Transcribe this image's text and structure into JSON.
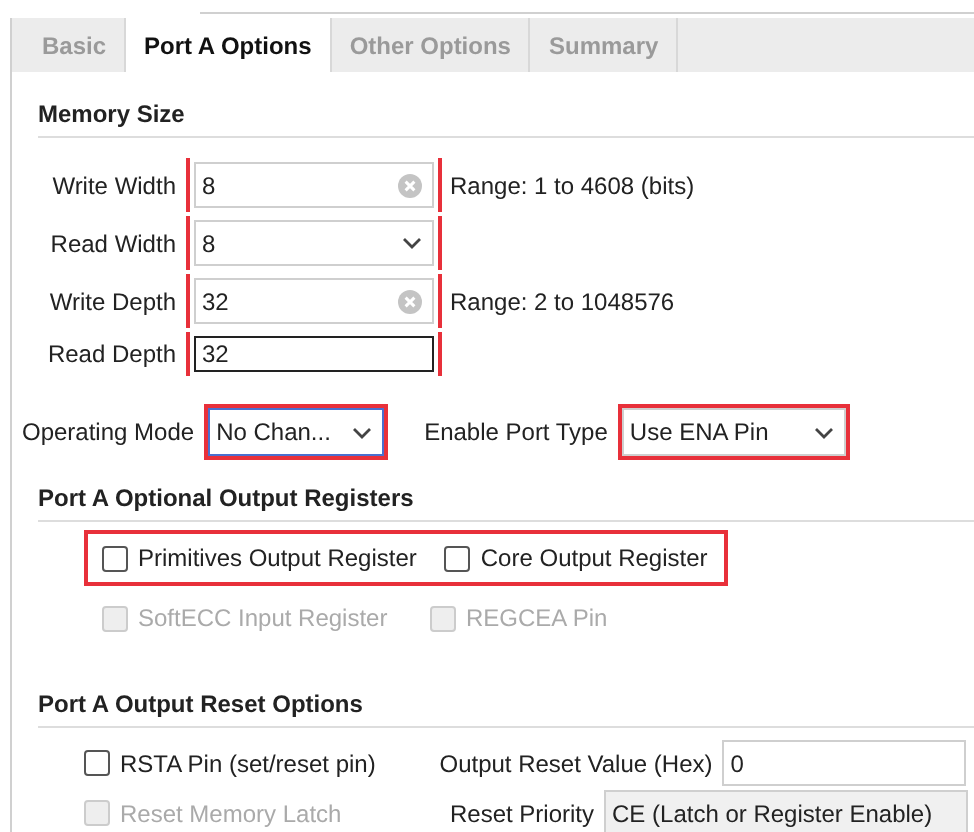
{
  "tabs": [
    {
      "label": "Basic",
      "selected": false
    },
    {
      "label": "Port A Options",
      "selected": true
    },
    {
      "label": "Other Options",
      "selected": false
    },
    {
      "label": "Summary",
      "selected": false
    }
  ],
  "memory_size": {
    "title": "Memory Size",
    "highlighted": true,
    "fields": [
      {
        "label": "Write Width",
        "value": "8",
        "kind": "clearable",
        "hint": "Range: 1 to 4608 (bits)"
      },
      {
        "label": "Read Width",
        "value": "8",
        "kind": "dropdown"
      },
      {
        "label": "Write Depth",
        "value": "32",
        "kind": "clearable",
        "hint": "Range: 2 to 1048576"
      },
      {
        "label": "Read Depth",
        "value": "32",
        "kind": "readonly"
      }
    ]
  },
  "modes": [
    {
      "label": "Operating Mode",
      "value": "No Chan...",
      "highlighted": true,
      "focused": true
    },
    {
      "label": "Enable Port Type",
      "value": "Use ENA Pin",
      "highlighted": true,
      "focused": false
    }
  ],
  "output_registers": {
    "title": "Port A Optional Output Registers",
    "rows": [
      {
        "highlighted": true,
        "items": [
          {
            "label": "Primitives Output Register",
            "checked": false,
            "disabled": false
          },
          {
            "label": "Core Output Register",
            "checked": false,
            "disabled": false
          }
        ]
      },
      {
        "highlighted": false,
        "items": [
          {
            "label": "SoftECC Input Register",
            "checked": false,
            "disabled": true
          },
          {
            "label": "REGCEA Pin",
            "checked": false,
            "disabled": true
          }
        ]
      }
    ]
  },
  "reset_options": {
    "title": "Port A Output Reset Options",
    "rows": [
      {
        "check": {
          "label": "RSTA Pin (set/reset pin)",
          "checked": false,
          "disabled": false
        },
        "label": "Output Reset Value (Hex)",
        "value": "0",
        "disabled": false
      },
      {
        "check": {
          "label": "Reset Memory Latch",
          "checked": false,
          "disabled": true
        },
        "label": "Reset Priority",
        "value": "CE (Latch or Register Enable)",
        "disabled": true
      }
    ]
  }
}
